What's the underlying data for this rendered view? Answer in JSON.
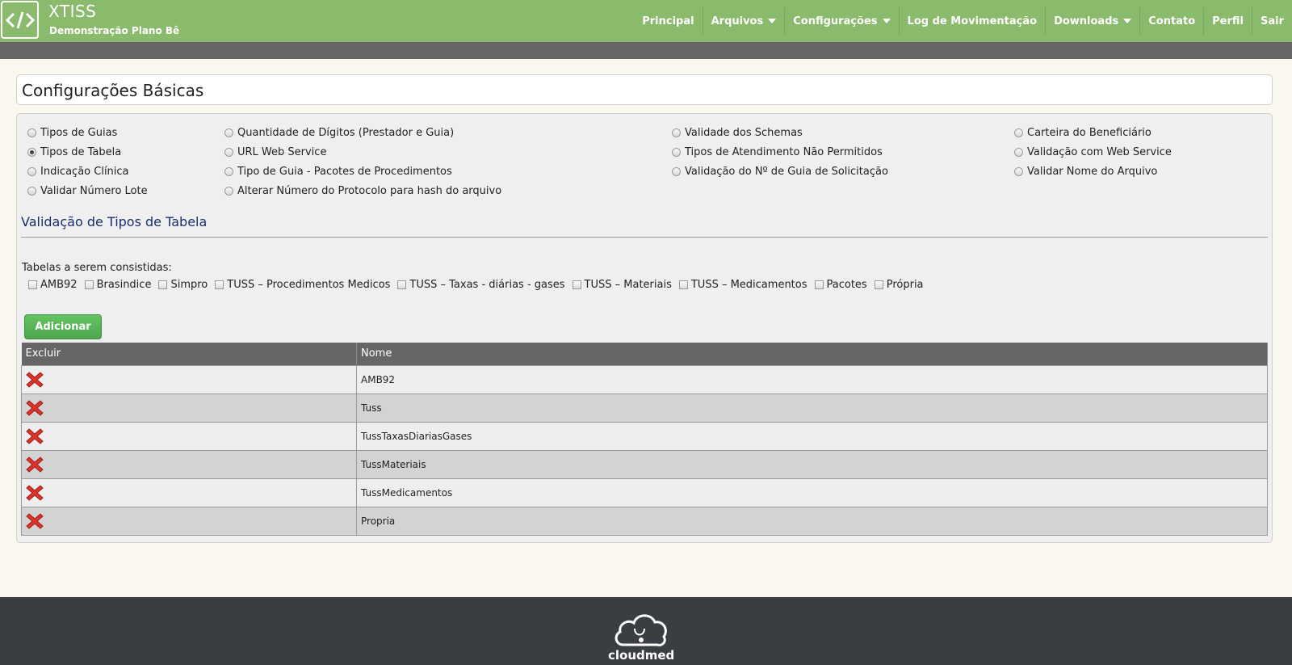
{
  "header": {
    "brand": "XTISS",
    "subtitle": "Demonstração Plano Bê",
    "logo_icon": "code-brackets-icon",
    "nav": [
      {
        "label": "Principal",
        "dropdown": false
      },
      {
        "label": "Arquivos",
        "dropdown": true
      },
      {
        "label": "Configurações",
        "dropdown": true
      },
      {
        "label": "Log de Movimentação",
        "dropdown": false
      },
      {
        "label": "Downloads",
        "dropdown": true
      },
      {
        "label": "Contato",
        "dropdown": false
      },
      {
        "label": "Perfil",
        "dropdown": false
      },
      {
        "label": "Sair",
        "dropdown": false
      }
    ],
    "colors": {
      "accent": "#8aba6c",
      "subbar": "#666666"
    }
  },
  "page": {
    "title": "Configurações Básicas"
  },
  "options": {
    "col1": [
      "Tipos de Guias",
      "Tipos de Tabela",
      "Indicação Clínica",
      "Validar Número Lote"
    ],
    "col2": [
      "Quantidade de Dígitos (Prestador e Guia)",
      "URL Web Service",
      "Tipo de Guia - Pacotes de Procedimentos",
      "Alterar Número do Protocolo para hash do arquivo"
    ],
    "col3": [
      "Validade dos Schemas",
      "Tipos de Atendimento Não Permitidos",
      "Validação do Nº de Guia de Solicitação"
    ],
    "col4": [
      "Carteira do Beneficiário",
      "Validação com Web Service",
      "Validar Nome do Arquivo"
    ],
    "selected": "Tipos de Tabela"
  },
  "section": {
    "title": "Validação de Tipos de Tabela",
    "tables_label": "Tabelas a serem consistidas:",
    "checkboxes": [
      "AMB92",
      "Brasindice",
      "Simpro",
      "TUSS – Procedimentos Medicos",
      "TUSS – Taxas - diárias - gases",
      "TUSS – Materiais",
      "TUSS – Medicamentos",
      "Pacotes",
      "Própria"
    ],
    "add_button": "Adicionar"
  },
  "table": {
    "headers": [
      "Excluir",
      "Nome"
    ],
    "rows": [
      "AMB92",
      "Tuss",
      "TussTaxasDiariasGases",
      "TussMateriais",
      "TussMedicamentos",
      "Propria"
    ],
    "delete_icon": "red-x-delete-icon"
  },
  "footer": {
    "logo_text": "cloudmed",
    "logo_icon": "cloud-stethoscope-icon"
  }
}
